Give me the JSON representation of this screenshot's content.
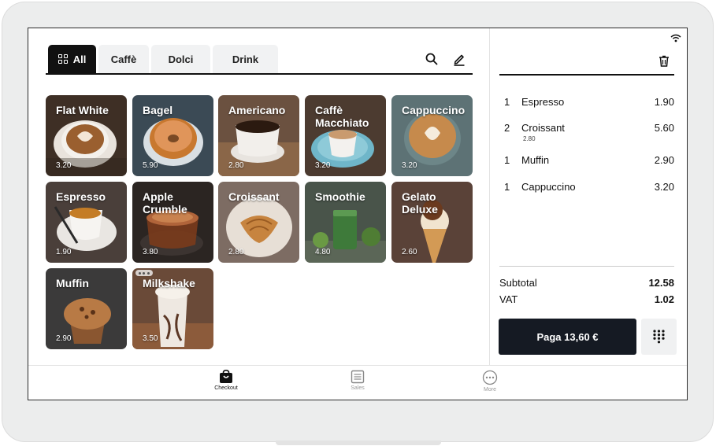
{
  "tabs": [
    {
      "label": "All",
      "active": true
    },
    {
      "label": "Caffè"
    },
    {
      "label": "Dolci"
    },
    {
      "label": "Drink"
    }
  ],
  "toolbar_icons": [
    "search-icon",
    "edit-icon"
  ],
  "products": [
    {
      "name": "Flat White",
      "price": "3.20"
    },
    {
      "name": "Bagel",
      "price": "5.90"
    },
    {
      "name": "Americano",
      "price": "2.80"
    },
    {
      "name": "Caffè Macchiato",
      "price": "3.20"
    },
    {
      "name": "Cappuccino",
      "price": "3.20"
    },
    {
      "name": "Espresso",
      "price": "1.90"
    },
    {
      "name": "Apple Crumble",
      "price": "3.80"
    },
    {
      "name": "Croissant",
      "price": "2.80"
    },
    {
      "name": "Smoothie",
      "price": "4.80"
    },
    {
      "name": "Gelato Deluxe",
      "price": "2.60"
    },
    {
      "name": "Muffin",
      "price": "2.90"
    },
    {
      "name": "Milkshake",
      "price": "3.50"
    }
  ],
  "cart": {
    "lines": [
      {
        "qty": "1",
        "name": "Espresso",
        "price": "1.90",
        "unit": ""
      },
      {
        "qty": "2",
        "name": "Croissant",
        "price": "5.60",
        "unit": "2.80"
      },
      {
        "qty": "1",
        "name": "Muffin",
        "price": "2.90",
        "unit": ""
      },
      {
        "qty": "1",
        "name": "Cappuccino",
        "price": "3.20",
        "unit": ""
      }
    ],
    "subtotal_label": "Subtotal",
    "subtotal": "12.58",
    "vat_label": "VAT",
    "vat": "1.02",
    "pay_label": "Paga 13,60 €"
  },
  "nav": [
    {
      "label": "Checkout",
      "icon": "bag-icon",
      "active": true
    },
    {
      "label": "Sales",
      "icon": "receipt-icon"
    },
    {
      "label": "More",
      "icon": "more-icon"
    }
  ],
  "colors": {
    "accent": "#111111",
    "pay_button": "#151a23",
    "tab_bg": "#f1f2f3"
  }
}
